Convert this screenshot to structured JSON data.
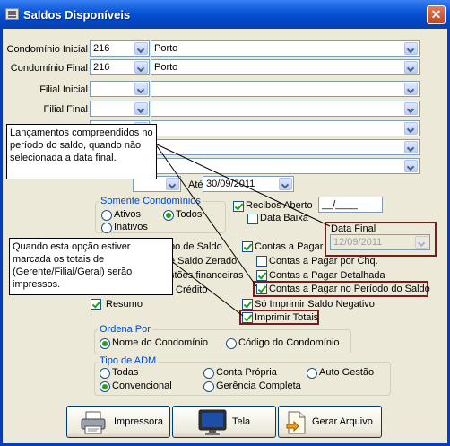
{
  "window": {
    "title": "Saldos Disponíveis",
    "close_glyph": "✕"
  },
  "filters": {
    "condominio_inicial": {
      "label": "Condomínio Inicial",
      "code": "216",
      "name": "Porto"
    },
    "condominio_final": {
      "label": "Condomínio Final",
      "code": "216",
      "name": "Porto"
    },
    "filial_inicial": {
      "label": "Filial Inicial",
      "code": "",
      "name": ""
    },
    "filial_final": {
      "label": "Filial Final",
      "code": "",
      "name": ""
    }
  },
  "ate": {
    "label": "Até",
    "value": "30/09/2011"
  },
  "somente_condominios": {
    "title": "Somente Condomínios",
    "ativos": "Ativos",
    "todos": "Todos",
    "inativos": "Inativos",
    "selected": "Todos"
  },
  "recibos_aberto": {
    "label": "Recibos Aberto",
    "value": "__/____",
    "checked": true
  },
  "data_baixa": {
    "label": "Data Baixa",
    "checked": false
  },
  "data_final": {
    "label": "Data Final",
    "value": "12/09/2011"
  },
  "left_options": {
    "saldo_label_fragment": "po de Saldo",
    "saldo_zerado_fragment": "e Saldo Zerado",
    "questoes_fragment": "stões financeiras",
    "credito_fragment": "Crédito",
    "resumo": "Resumo"
  },
  "right_options": [
    {
      "label": "Contas a Pagar",
      "checked": true
    },
    {
      "label": "Contas a Pagar por Chq.",
      "checked": false
    },
    {
      "label": "Contas a Pagar Detalhada",
      "checked": true
    },
    {
      "label": "Contas a Pagar no Período do Saldo",
      "checked": true
    },
    {
      "label": "Só Imprimir Saldo Negativo",
      "checked": true
    },
    {
      "label": "Imprimir Totais",
      "checked": true
    }
  ],
  "ordena_por": {
    "title": "Ordena Por",
    "nome": "Nome do Condomínio",
    "codigo": "Código do Condomínio",
    "selected": "Nome do Condomínio"
  },
  "tipo_adm": {
    "title": "Tipo de ADM",
    "todas": "Todas",
    "conta_propria": "Conta Própria",
    "auto_gestao": "Auto Gestão",
    "convencional": "Convencional",
    "gerencia_completa": "Gerência Completa",
    "selected": "Convencional"
  },
  "tooltips": {
    "lancamentos": "Lançamentos compreendidos no período do saldo, quando não selecionada a data final.",
    "totais": "Quando esta opção estiver marcada os totais de (Gerente/Filial/Geral) serão impressos."
  },
  "buttons": {
    "impressora": "Impressora",
    "tela": "Tela",
    "gerar_arquivo": "Gerar Arquivo"
  },
  "colors": {
    "title_bar": "#0a57d8",
    "highlight_border": "#7a1c1c",
    "group_title": "#0046d5",
    "check": "#21a121"
  }
}
